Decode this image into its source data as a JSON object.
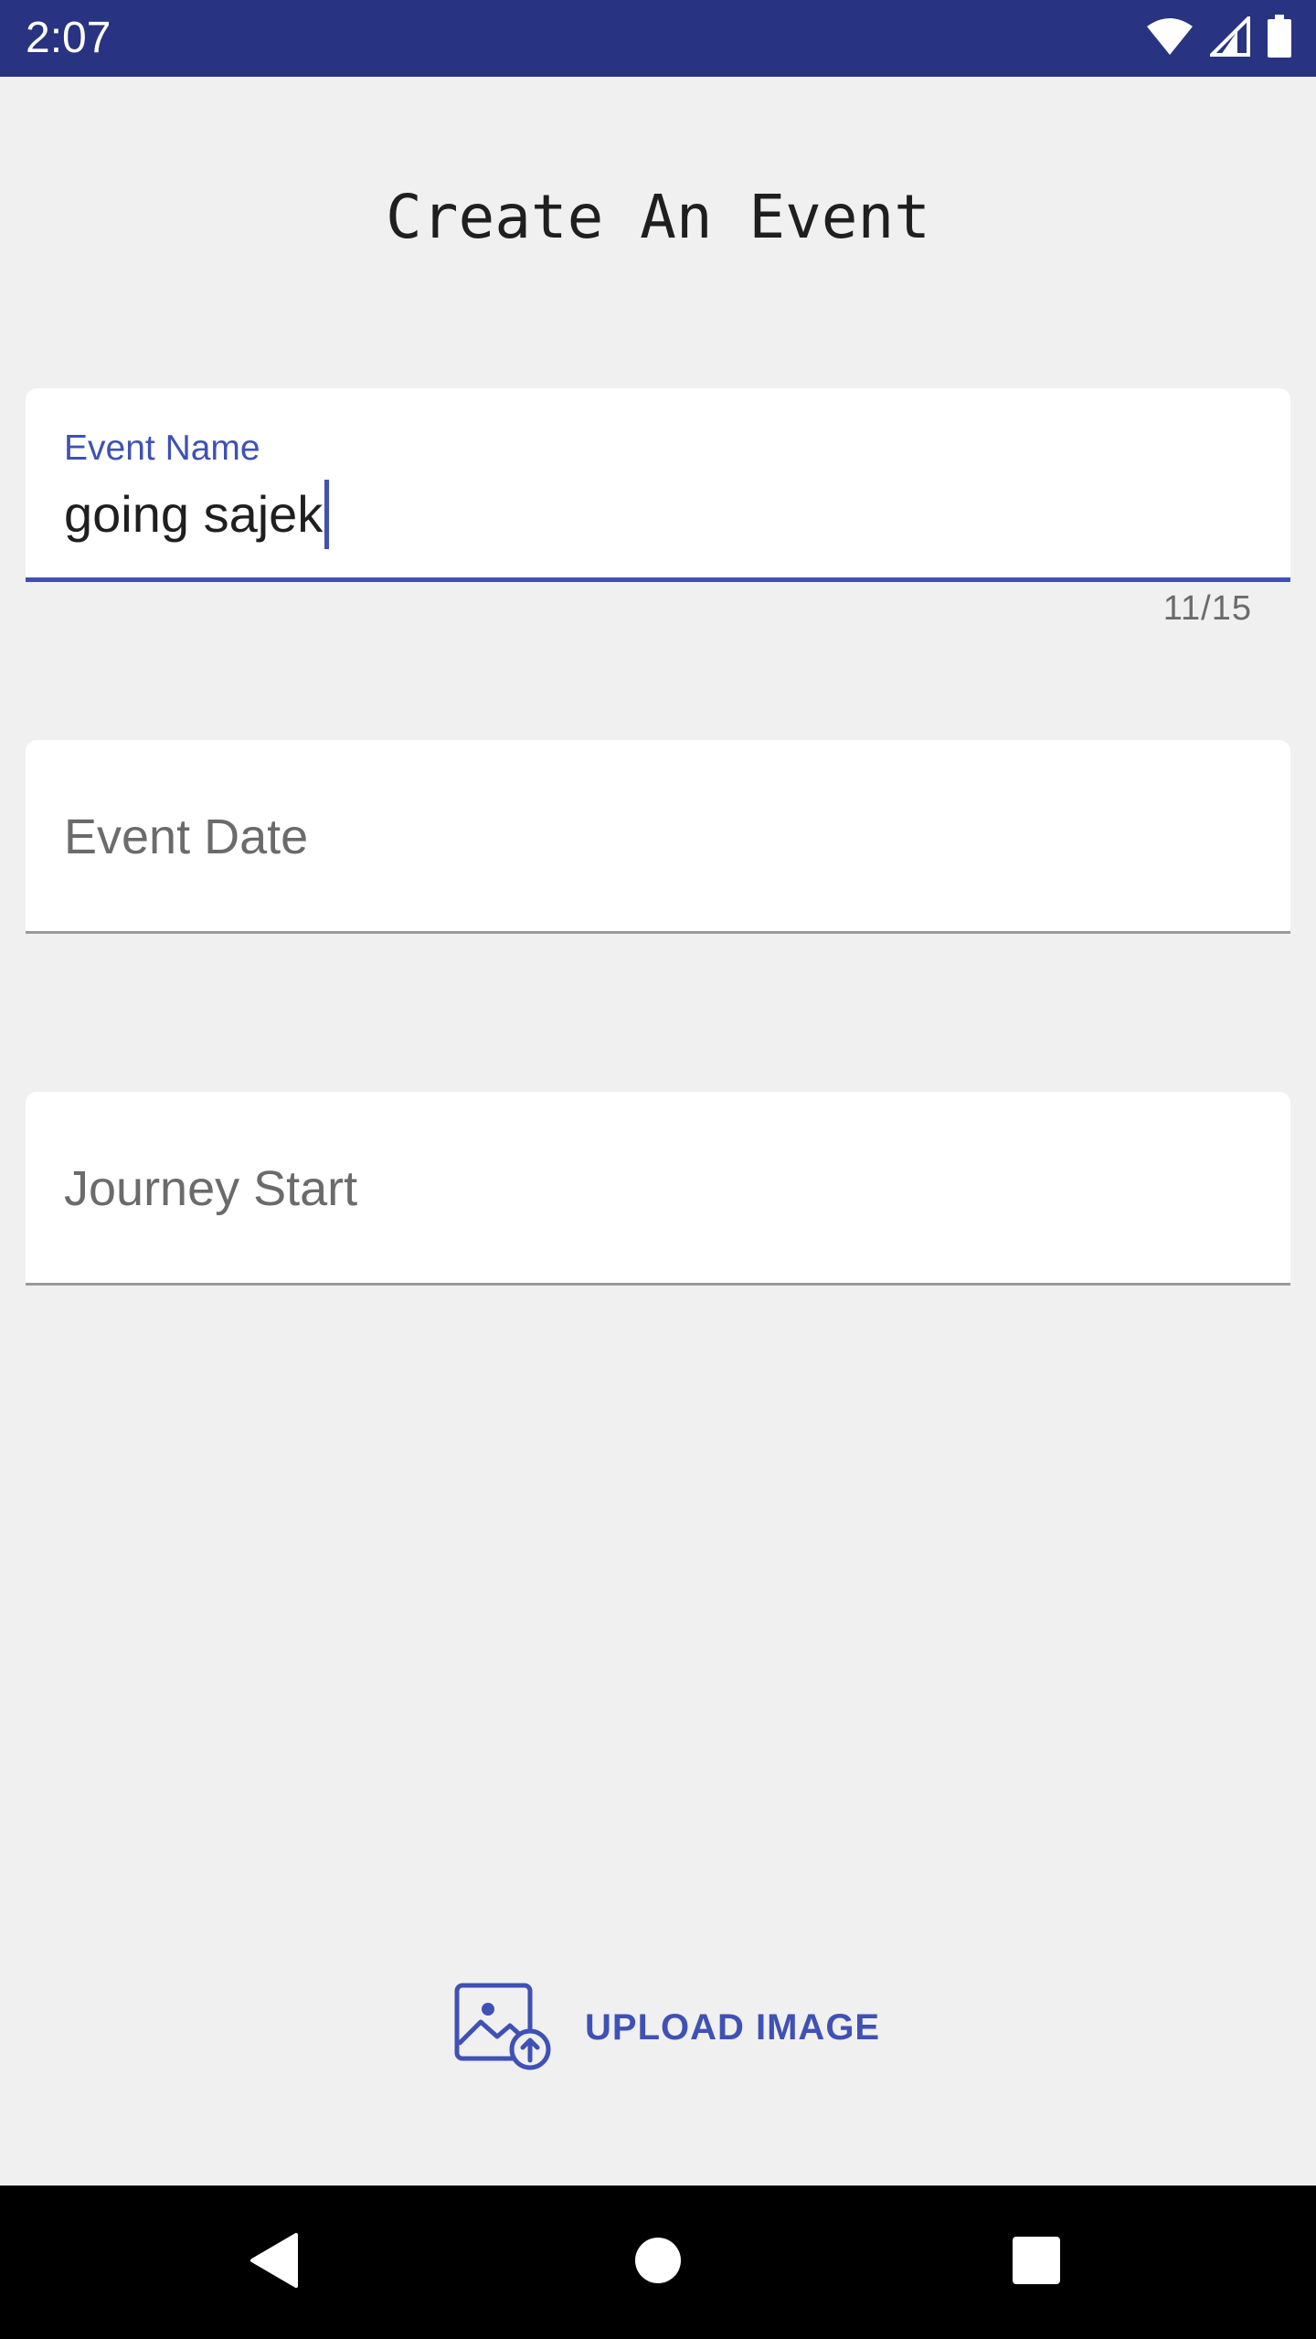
{
  "status_bar": {
    "time": "2:07",
    "icons": [
      "wifi-icon",
      "cell-signal-icon",
      "battery-icon"
    ]
  },
  "page": {
    "title": "Create An Event"
  },
  "form": {
    "event_name": {
      "label": "Event Name",
      "value": "going sajek",
      "counter": "11/15"
    },
    "event_date": {
      "placeholder": "Event Date"
    },
    "journey_start": {
      "placeholder": "Journey Start"
    }
  },
  "upload": {
    "label": "UPLOAD IMAGE",
    "icon": "image-upload-icon"
  },
  "nav_bar": {
    "icons": [
      "back-icon",
      "home-icon",
      "recents-icon"
    ]
  },
  "colors": {
    "status_bar": "#283382",
    "accent": "#3f51b5",
    "background": "#f0f0f0"
  }
}
